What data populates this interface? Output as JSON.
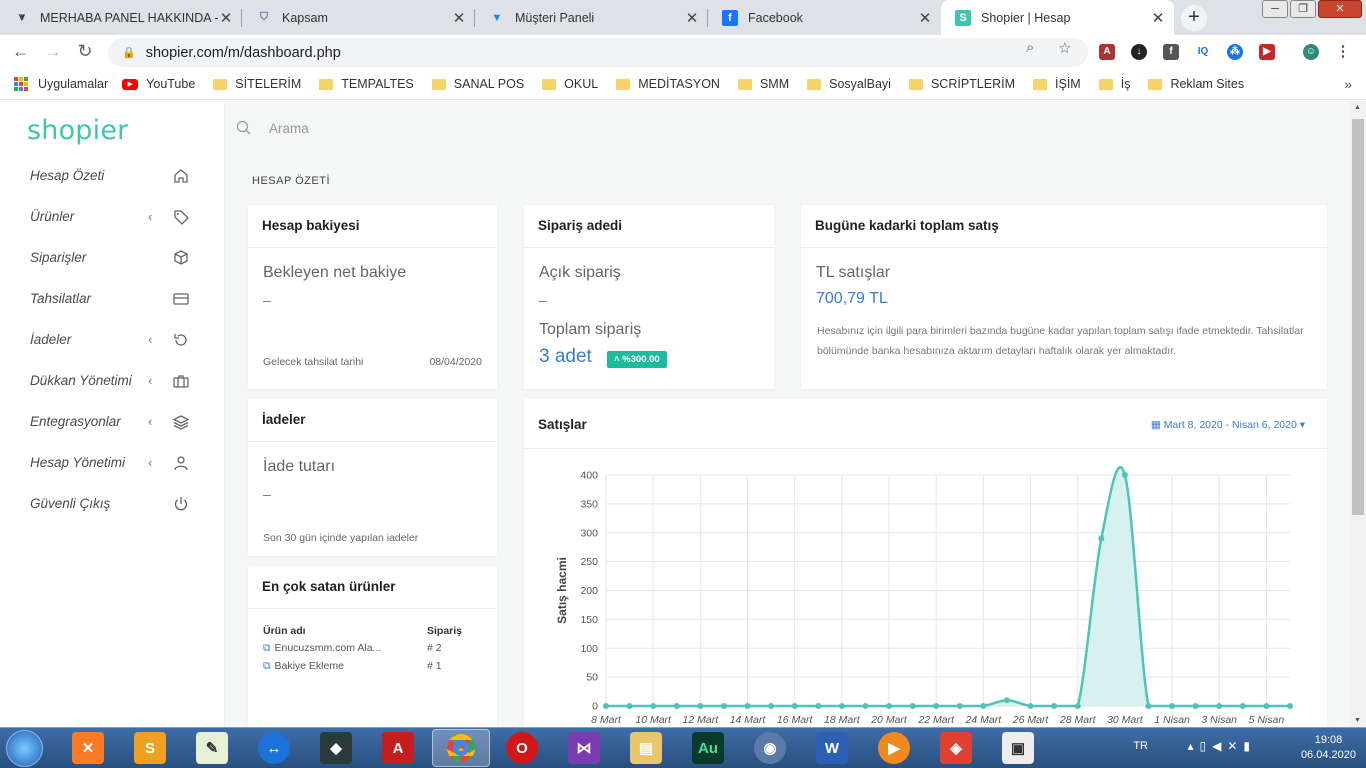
{
  "browser": {
    "tabs": [
      {
        "title": "MERHABA PANEL HAKKINDA - İ",
        "icon": "panel-icon"
      },
      {
        "title": "Kapsam",
        "icon": "shield-icon"
      },
      {
        "title": "Müşteri Paneli",
        "icon": "funnel-icon"
      },
      {
        "title": "Facebook",
        "icon": "facebook-icon"
      },
      {
        "title": "Shopier | Hesap",
        "icon": "shopier-icon"
      }
    ],
    "url": "shopier.com/m/dashboard.php",
    "bookmarks": [
      "Uygulamalar",
      "YouTube",
      "SİTELERİM",
      "TEMPALTES",
      "SANAL POS",
      "OKUL",
      "MEDİTASYON",
      "SMM",
      "SosyalBayi",
      "SCRİPTLERİM",
      "İŞİM",
      "İş",
      "Reklam Sites"
    ]
  },
  "sidebar": {
    "logo": "shopier",
    "items": [
      {
        "label": "Hesap Özeti",
        "icon": "home-icon",
        "chevron": ""
      },
      {
        "label": "Ürünler",
        "icon": "tag-icon",
        "chevron": "‹"
      },
      {
        "label": "Siparişler",
        "icon": "box-icon",
        "chevron": ""
      },
      {
        "label": "Tahsilatlar",
        "icon": "card-icon",
        "chevron": ""
      },
      {
        "label": "İadeler",
        "icon": "undo-icon",
        "chevron": "‹"
      },
      {
        "label": "Dükkan Yönetimi",
        "icon": "briefcase-icon",
        "chevron": "‹"
      },
      {
        "label": "Entegrasyonlar",
        "icon": "layers-icon",
        "chevron": "‹"
      },
      {
        "label": "Hesap Yönetimi",
        "icon": "user-icon",
        "chevron": "‹"
      },
      {
        "label": "Güvenli Çıkış",
        "icon": "power-icon",
        "chevron": ""
      }
    ]
  },
  "search": {
    "placeholder": "Arama"
  },
  "section_title": "HESAP ÖZETİ",
  "balance": {
    "title": "Hesap bakiyesi",
    "label": "Bekleyen net bakiye",
    "value": "–",
    "footer_label": "Gelecek tahsilat tarihi",
    "footer_value": "08/04/2020"
  },
  "orders": {
    "title": "Sipariş adedi",
    "open_label": "Açık sipariş",
    "open_value": "–",
    "total_label": "Toplam sipariş",
    "total_value": "3 adet",
    "badge": "˄ %300.00"
  },
  "total_sales": {
    "title": "Bugüne kadarki toplam satış",
    "label": "TL satışlar",
    "value": "700,79 TL",
    "description": "Hesabınız için ilgili para birimleri bazında bugüne kadar yapılan toplam satışı ifade etmektedir. Tahsilatlar bölümünde banka hesabınıza aktarım detayları haftalık olarak yer almaktadır."
  },
  "returns": {
    "title": "İadeler",
    "label": "İade tutarı",
    "value": "–",
    "footer": "Son 30 gün içinde yapılan iadeler"
  },
  "top_products": {
    "title": "En çok satan ürünler",
    "col_name": "Ürün adı",
    "col_orders": "Sipariş",
    "rows": [
      {
        "name": "Enucuzsmm.com Ala...",
        "orders": "# 2"
      },
      {
        "name": "Bakiye Ekleme",
        "orders": "# 1"
      }
    ]
  },
  "sales_chart": {
    "title": "Satışlar",
    "date_range": "Mart 8, 2020 - Nisan 6, 2020 ▾"
  },
  "chart_data": {
    "type": "area",
    "ylabel": "Satış hacmi",
    "ylim": [
      0,
      400
    ],
    "yticks": [
      0,
      50,
      100,
      150,
      200,
      250,
      300,
      350,
      400
    ],
    "xticks": [
      "8 Mart",
      "10 Mart",
      "12 Mart",
      "14 Mart",
      "16 Mart",
      "18 Mart",
      "20 Mart",
      "22 Mart",
      "24 Mart",
      "26 Mart",
      "28 Mart",
      "30 Mart",
      "1 Nisan",
      "3 Nisan",
      "5 Nisan"
    ],
    "x": [
      "8 Mart",
      "9 Mart",
      "10 Mart",
      "11 Mart",
      "12 Mart",
      "13 Mart",
      "14 Mart",
      "15 Mart",
      "16 Mart",
      "17 Mart",
      "18 Mart",
      "19 Mart",
      "20 Mart",
      "21 Mart",
      "22 Mart",
      "23 Mart",
      "24 Mart",
      "25 Mart",
      "26 Mart",
      "27 Mart",
      "28 Mart",
      "29 Mart",
      "30 Mart",
      "31 Mart",
      "1 Nisan",
      "2 Nisan",
      "3 Nisan",
      "4 Nisan",
      "5 Nisan",
      "6 Nisan"
    ],
    "values": [
      0,
      0,
      0,
      0,
      0,
      0,
      0,
      0,
      0,
      0,
      0,
      0,
      0,
      0,
      0,
      0,
      0,
      10,
      0,
      0,
      0,
      290,
      400,
      0,
      0,
      0,
      0,
      0,
      0,
      0
    ],
    "grid": true,
    "color": "#4fc3b8",
    "fill": "#d6f1ee"
  },
  "taskbar": {
    "lang": "TR",
    "time": "19:08",
    "date": "06.04.2020"
  }
}
